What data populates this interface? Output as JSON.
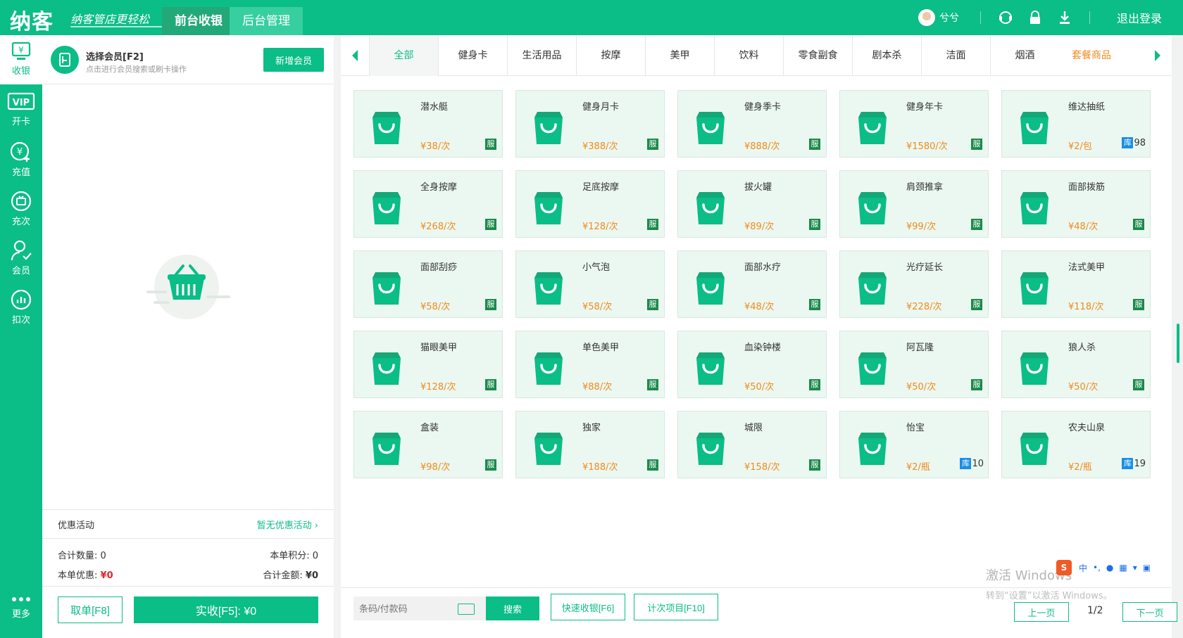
{
  "brand": {
    "logo": "纳客",
    "slogan": "纳客管店更轻松"
  },
  "topnav": {
    "tabs": [
      "前台收银",
      "后台管理"
    ],
    "active_index": 0
  },
  "user": {
    "name": "兮兮",
    "logout": "退出登录"
  },
  "sidebar": {
    "items": [
      {
        "label": "收银",
        "icon": "cash-icon",
        "active": true
      },
      {
        "label": "开卡",
        "icon": "vip-card-icon"
      },
      {
        "label": "充值",
        "icon": "recharge-icon"
      },
      {
        "label": "充次",
        "icon": "recharge-times-icon"
      },
      {
        "label": "会员",
        "icon": "member-icon"
      },
      {
        "label": "扣次",
        "icon": "deduct-icon"
      },
      {
        "label": "更多",
        "icon": "more-icon"
      }
    ]
  },
  "member": {
    "title": "选择会员[F2]",
    "subtitle": "点击进行会员搜索或刷卡操作",
    "new_button": "新增会员"
  },
  "promo": {
    "label": "优惠活动",
    "value": "暂无优惠活动"
  },
  "totals": {
    "count_label": "合计数量:",
    "count": "0",
    "points_label": "本单积分:",
    "points": "0",
    "discount_label": "本单优惠:",
    "discount": "¥0",
    "amount_label": "合计金额:",
    "amount": "¥0"
  },
  "actions": {
    "cancel": "取单[F8]",
    "pay": "实收[F5]: ¥0"
  },
  "categories": [
    "全部",
    "健身卡",
    "生活用品",
    "按摩",
    "美甲",
    "饮料",
    "零食副食",
    "剧本杀",
    "洁面",
    "烟酒",
    "套餐商品"
  ],
  "active_category": 0,
  "products": [
    {
      "name": "潜水艇",
      "price": "¥38/次",
      "tag": "服"
    },
    {
      "name": "健身月卡",
      "price": "¥388/次",
      "tag": "服"
    },
    {
      "name": "健身季卡",
      "price": "¥888/次",
      "tag": "服"
    },
    {
      "name": "健身年卡",
      "price": "¥1580/次",
      "tag": "服"
    },
    {
      "name": "维达抽纸",
      "price": "¥2/包",
      "tag": "库",
      "stock": "98"
    },
    {
      "name": "全身按摩",
      "price": "¥268/次",
      "tag": "服"
    },
    {
      "name": "足底按摩",
      "price": "¥128/次",
      "tag": "服"
    },
    {
      "name": "拔火罐",
      "price": "¥89/次",
      "tag": "服"
    },
    {
      "name": "肩颈推拿",
      "price": "¥99/次",
      "tag": "服"
    },
    {
      "name": "面部拨筋",
      "price": "¥48/次",
      "tag": "服"
    },
    {
      "name": "面部刮痧",
      "price": "¥58/次",
      "tag": "服"
    },
    {
      "name": "小气泡",
      "price": "¥58/次",
      "tag": "服"
    },
    {
      "name": "面部水疗",
      "price": "¥48/次",
      "tag": "服"
    },
    {
      "name": "光疗延长",
      "price": "¥228/次",
      "tag": "服"
    },
    {
      "name": "法式美甲",
      "price": "¥118/次",
      "tag": "服"
    },
    {
      "name": "猫眼美甲",
      "price": "¥128/次",
      "tag": "服"
    },
    {
      "name": "单色美甲",
      "price": "¥88/次",
      "tag": "服"
    },
    {
      "name": "血染钟楼",
      "price": "¥50/次",
      "tag": "服"
    },
    {
      "name": "阿瓦隆",
      "price": "¥50/次",
      "tag": "服"
    },
    {
      "name": "狼人杀",
      "price": "¥50/次",
      "tag": "服"
    },
    {
      "name": "盒装",
      "price": "¥98/次",
      "tag": "服"
    },
    {
      "name": "独家",
      "price": "¥188/次",
      "tag": "服"
    },
    {
      "name": "城限",
      "price": "¥158/次",
      "tag": "服"
    },
    {
      "name": "怡宝",
      "price": "¥2/瓶",
      "tag": "库",
      "stock": "10"
    },
    {
      "name": "农夫山泉",
      "price": "¥2/瓶",
      "tag": "库",
      "stock": "19"
    }
  ],
  "search": {
    "placeholder": "条码/付款码",
    "button": "搜索"
  },
  "quick": {
    "fast_checkout": "快速收银[F6]",
    "count_items": "计次项目[F10]"
  },
  "pager": {
    "prev": "上一页",
    "page": "1/2",
    "next": "下一页"
  },
  "os": {
    "watermark_title": "激活 Windows",
    "watermark_sub": "转到“设置”以激活 Windows。",
    "ime_lang": "中"
  },
  "colors": {
    "brand": "#0bbd87",
    "price": "#f08a1c",
    "service_tag": "#1a8a4a",
    "stock_tag": "#1b8fe6"
  }
}
